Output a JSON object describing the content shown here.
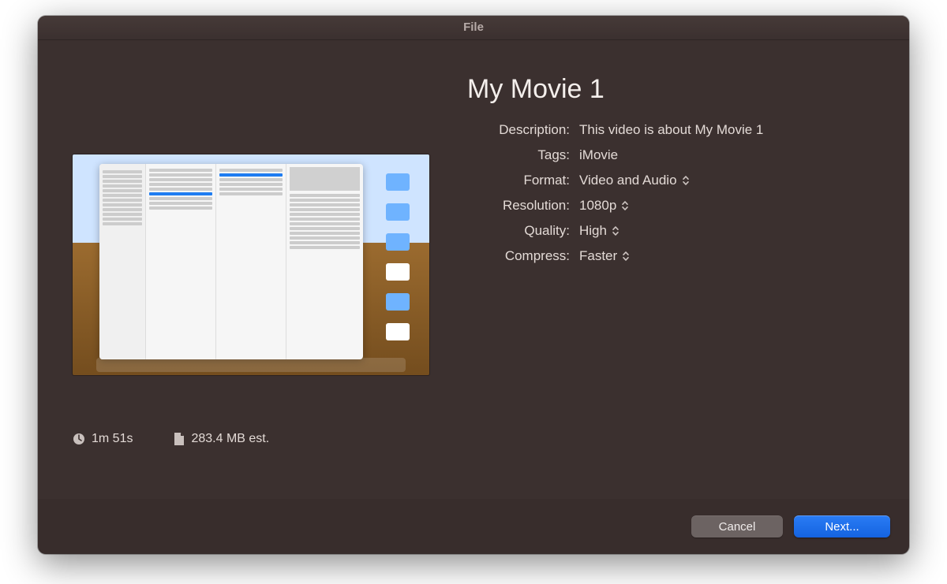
{
  "window": {
    "title": "File"
  },
  "movie": {
    "title": "My Movie 1",
    "description_label": "Description:",
    "description_value": "This video is about My Movie 1",
    "tags_label": "Tags:",
    "tags_value": "iMovie",
    "format_label": "Format:",
    "format_value": "Video and Audio",
    "resolution_label": "Resolution:",
    "resolution_value": "1080p",
    "quality_label": "Quality:",
    "quality_value": "High",
    "compress_label": "Compress:",
    "compress_value": "Faster"
  },
  "stats": {
    "duration": "1m 51s",
    "filesize": "283.4 MB est."
  },
  "buttons": {
    "cancel": "Cancel",
    "next": "Next..."
  }
}
